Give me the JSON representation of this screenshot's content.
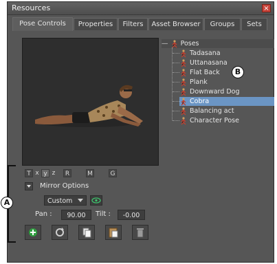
{
  "window": {
    "title": "Resources",
    "close_glyph": "×"
  },
  "tabs": [
    {
      "label": "Pose Controls",
      "active": true
    },
    {
      "label": "Properties"
    },
    {
      "label": "Filters"
    },
    {
      "label": "Asset Browser"
    },
    {
      "label": "Groups"
    },
    {
      "label": "Sets"
    }
  ],
  "tree": {
    "collapse_glyph": "—",
    "root": "Poses",
    "items": [
      "Tadasana",
      "Uttanasana",
      "Flat Back",
      "Plank",
      "Downward Dog",
      "Cobra",
      "Balancing act",
      "Character Pose"
    ],
    "selected": "Cobra"
  },
  "axis_buttons": {
    "t": "T",
    "x": "x",
    "y": "y",
    "z": "z",
    "r": "R",
    "m": "M",
    "g": "G"
  },
  "mirror": {
    "label": "Mirror Options",
    "mode": "Custom"
  },
  "pan": {
    "label": "Pan :",
    "value": "90.00"
  },
  "tilt": {
    "label": "Tilt :",
    "value": "-0.00"
  },
  "toolbar_icons": [
    "add-icon",
    "refresh-icon",
    "copy-icon",
    "paste-icon",
    "trash-icon"
  ],
  "callouts": {
    "a": "A",
    "b": "B"
  },
  "colors": {
    "selection": "#6b95c4",
    "window_bg": "#565656",
    "viewport_bg": "#2e2e2e"
  }
}
